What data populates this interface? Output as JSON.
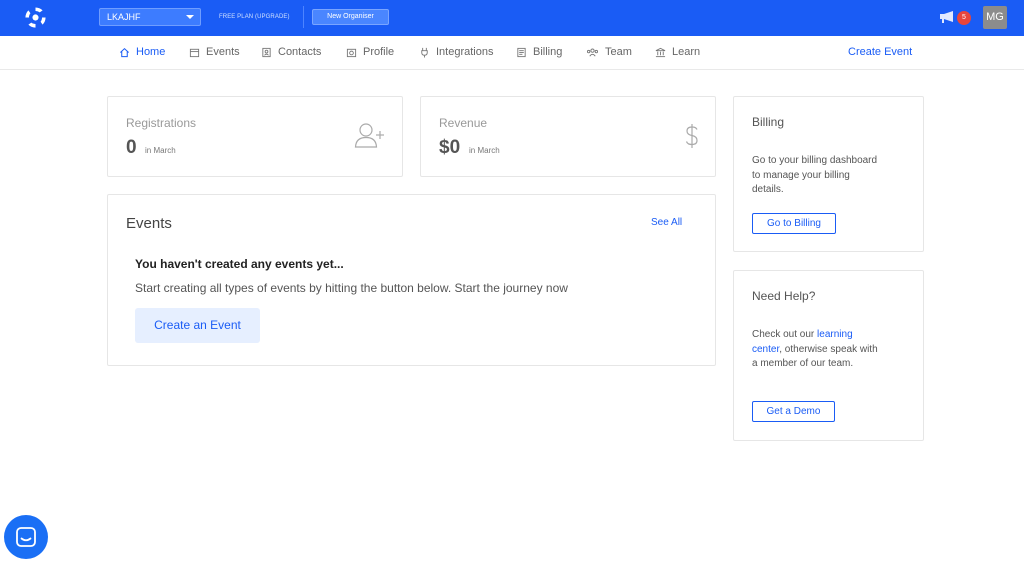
{
  "topbar": {
    "organisation": "LKAJHF",
    "plan_text": "FREE PLAN (UPGRADE)",
    "new_organiser": "New Organiser",
    "notification_count": "5",
    "avatar_initials": "MG",
    "brand_color": "#1a5cf5"
  },
  "nav": {
    "items": [
      {
        "label": "Home",
        "icon": "home-icon",
        "active": true
      },
      {
        "label": "Events",
        "icon": "calendar-icon"
      },
      {
        "label": "Contacts",
        "icon": "contact-card-icon"
      },
      {
        "label": "Profile",
        "icon": "profile-icon"
      },
      {
        "label": "Integrations",
        "icon": "plug-icon"
      },
      {
        "label": "Billing",
        "icon": "invoice-icon"
      },
      {
        "label": "Team",
        "icon": "team-icon"
      },
      {
        "label": "Learn",
        "icon": "institution-icon"
      }
    ],
    "create_event": "Create Event"
  },
  "stats": {
    "registrations": {
      "label": "Registrations",
      "value": "0",
      "period": "in March",
      "icon": "add-user-icon"
    },
    "revenue": {
      "label": "Revenue",
      "value": "$0",
      "period": "in March",
      "icon": "dollar-icon"
    }
  },
  "events": {
    "title": "Events",
    "see_all": "See All",
    "empty_title": "You haven't created any events yet...",
    "empty_text": "Start creating all types of events by hitting the button below. Start the journey now",
    "create_button": "Create an Event"
  },
  "billing": {
    "title": "Billing",
    "text": "Go to your billing dashboard to manage your billing details.",
    "button": "Go to Billing"
  },
  "help": {
    "title": "Need Help?",
    "text_before": "Check out our ",
    "link": "learning center",
    "text_after": ", otherwise speak with a member of our team.",
    "button": "Get a Demo"
  }
}
